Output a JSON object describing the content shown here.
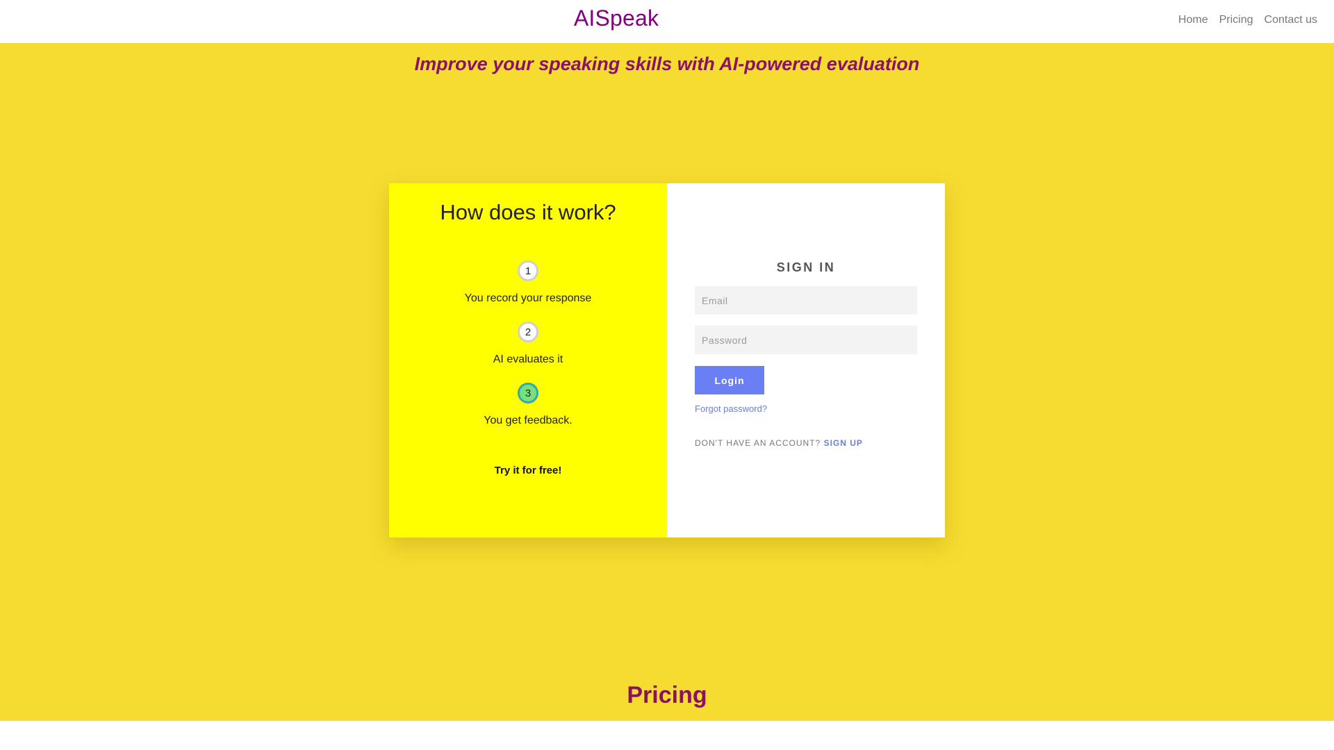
{
  "header": {
    "brand": "AISpeak",
    "nav": [
      "Home",
      "Pricing",
      "Contact us"
    ]
  },
  "hero": {
    "tagline": "Improve your speaking skills with AI-powered evaluation"
  },
  "how_it_works": {
    "title": "How does it work?",
    "steps": [
      {
        "number": "1",
        "text": "You record your response"
      },
      {
        "number": "2",
        "text": "AI evaluates it"
      },
      {
        "number": "3",
        "text": "You get feedback."
      }
    ],
    "cta": "Try it for free!"
  },
  "sign_in": {
    "title": "SIGN IN",
    "email_placeholder": "Email",
    "password_placeholder": "Password",
    "login_label": "Login",
    "forgot_label": "Forgot password?",
    "no_account_text": "DON'T HAVE AN ACCOUNT?",
    "signup_label": "SIGN UP"
  },
  "pricing": {
    "heading": "Pricing"
  },
  "colors": {
    "brand": "#800080",
    "hero_bg": "#f6dc30",
    "panel_yellow": "#ffff00",
    "button": "#6b7ff5",
    "link": "#6b7fcf",
    "tagline": "#8b1163"
  }
}
